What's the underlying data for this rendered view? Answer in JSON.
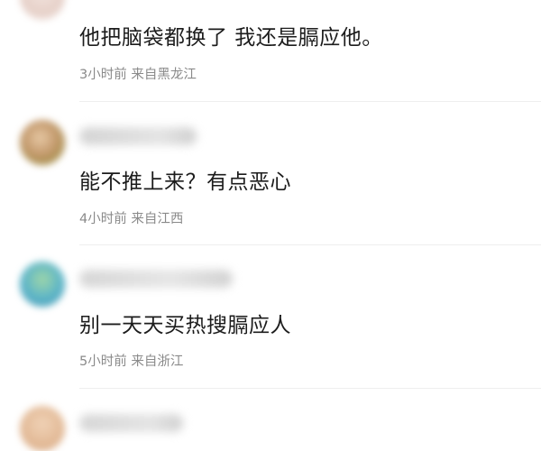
{
  "comments": [
    {
      "text": "他把脑袋都换了 我还是膈应他。",
      "time": "3小时前",
      "location": "来自黑龙江"
    },
    {
      "text": "能不推上来？有点恶心",
      "time": "4小时前",
      "location": "来自江西"
    },
    {
      "text": "别一天天买热搜膈应人",
      "time": "5小时前",
      "location": "来自浙江"
    },
    {
      "text": "",
      "time": "",
      "location": ""
    }
  ],
  "colors": {
    "avatar_1": "#e8d5cf",
    "avatar_2": "#c7a882",
    "avatar_3": "#5bb4c9",
    "avatar_4": "#e2b996",
    "username_blur": "#c8c8c8"
  }
}
